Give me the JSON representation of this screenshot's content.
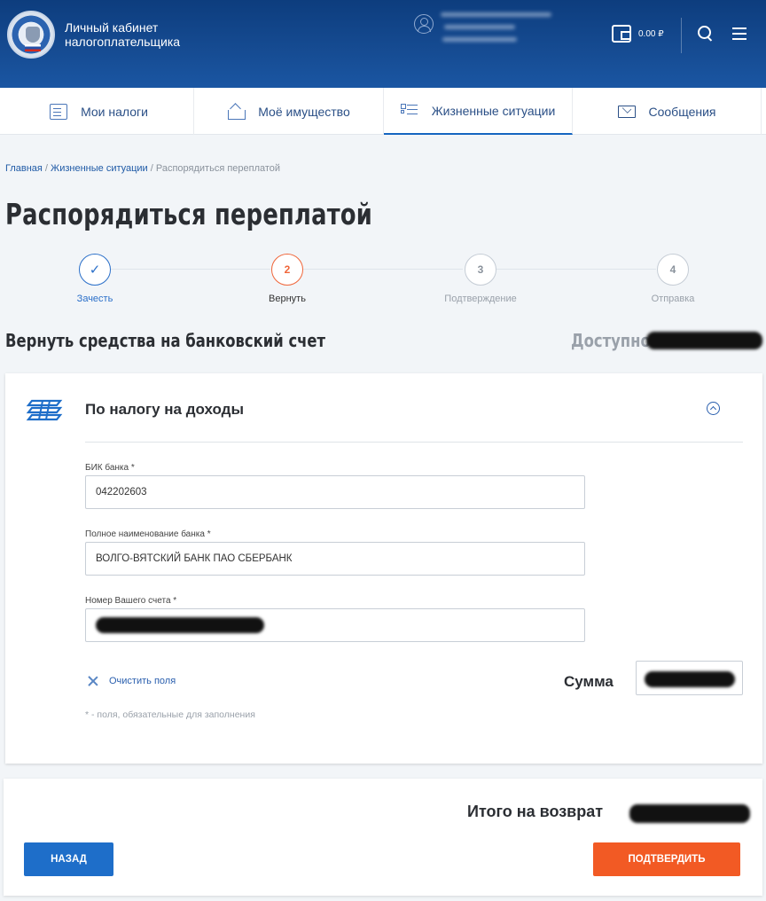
{
  "header": {
    "brand_line1": "Личный кабинет",
    "brand_line2": "налогоплательщика",
    "balance": "0.00 ₽"
  },
  "nav": {
    "tabs": [
      {
        "label": "Мои налоги",
        "icon": "taxes-icon"
      },
      {
        "label": "Моё имущество",
        "icon": "property-icon"
      },
      {
        "label": "Жизненные ситуации",
        "icon": "list-icon",
        "active": true
      },
      {
        "label": "Сообщения",
        "icon": "envelope-icon"
      }
    ]
  },
  "breadcrumb": {
    "home": "Главная",
    "sep": " / ",
    "section": "Жизненные ситуации",
    "current": "Распорядиться переплатой"
  },
  "page": {
    "title": "Распорядиться переплатой"
  },
  "stepper": {
    "steps": [
      {
        "number": "✓",
        "label": "Зачесть",
        "state": "done"
      },
      {
        "number": "2",
        "label": "Вернуть",
        "state": "current"
      },
      {
        "number": "3",
        "label": "Подтверждение",
        "state": "pending"
      },
      {
        "number": "4",
        "label": "Отправка",
        "state": "pending"
      }
    ]
  },
  "section": {
    "title": "Вернуть средства на банковский счет",
    "available_label": "Доступно"
  },
  "card": {
    "title": "По налогу на доходы",
    "bik_label": "БИК банка *",
    "bik_value": "042202603",
    "bank_name_label": "Полное наименование банка *",
    "bank_name_value": "ВОЛГО-ВЯТСКИЙ БАНК ПАО СБЕРБАНК",
    "account_label": "Номер Вашего счета *",
    "clear_label": "Очистить поля",
    "sum_label": "Сумма",
    "required_note": "* - поля, обязательные для заполнения"
  },
  "footer": {
    "total_label": "Итого на возврат",
    "back_button": "НАЗАД",
    "confirm_button": "ПОДТВЕРДИТЬ"
  },
  "colors": {
    "header_bg": "#164c93",
    "accent_blue": "#1e6ec9",
    "accent_orange": "#f25a24",
    "step_current": "#f0663a"
  }
}
